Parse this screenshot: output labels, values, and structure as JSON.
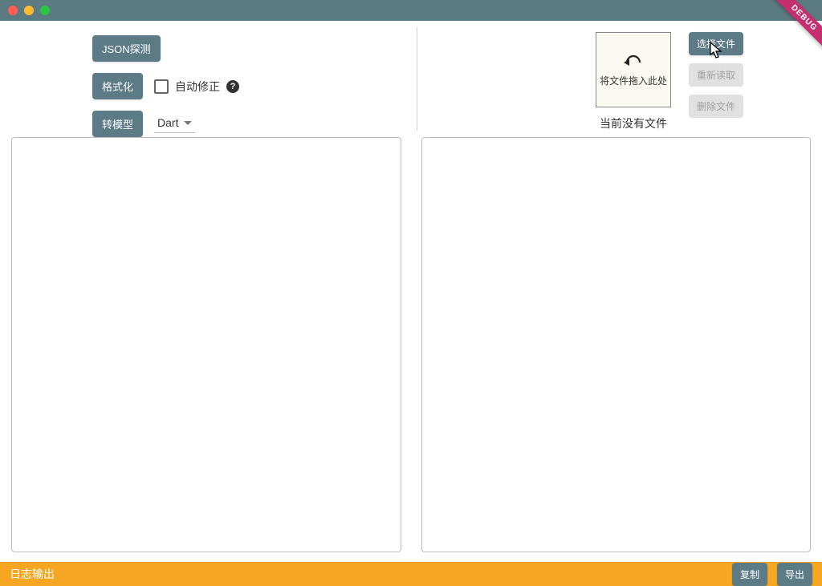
{
  "toolbar": {
    "json_probe_label": "JSON探测",
    "format_label": "格式化",
    "autofix_label": "自动修正",
    "to_model_label": "转模型",
    "language_value": "Dart"
  },
  "filearea": {
    "dropzone_text": "将文件拖入此处",
    "no_file_text": "当前没有文件",
    "select_file_label": "选择文件",
    "reread_label": "重新读取",
    "delete_file_label": "删除文件"
  },
  "logbar": {
    "title": "日志输出",
    "copy_label": "复制",
    "export_label": "导出"
  },
  "debug_banner": "DEBUG"
}
